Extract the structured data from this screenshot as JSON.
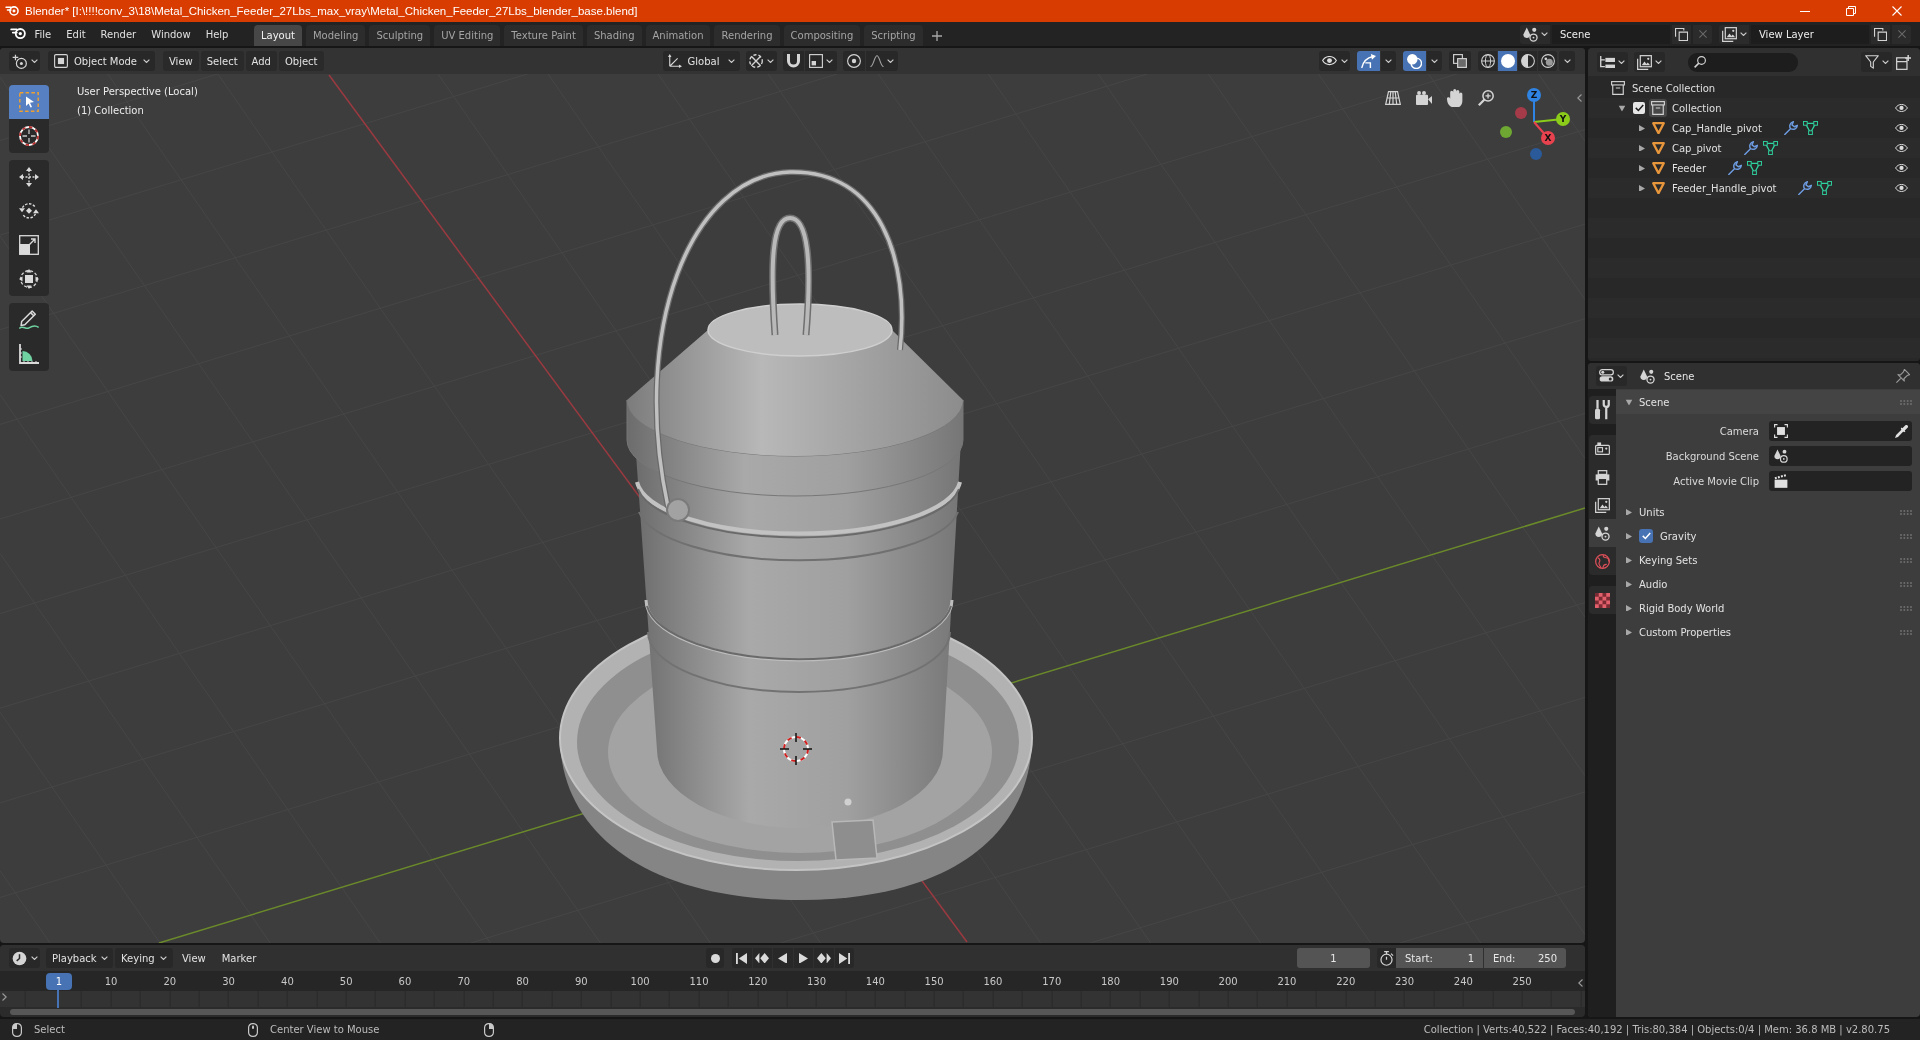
{
  "window": {
    "title": "Blender* [I:\\!!!!conv_3\\18\\Metal_Chicken_Feeder_27Lbs_max_vray\\Metal_Chicken_Feeder_27Lbs_blender_base.blend]"
  },
  "menu": [
    "File",
    "Edit",
    "Render",
    "Window",
    "Help"
  ],
  "workspaces": [
    {
      "label": "Layout",
      "selected": true
    },
    {
      "label": "Modeling",
      "selected": false
    },
    {
      "label": "Sculpting",
      "selected": false
    },
    {
      "label": "UV Editing",
      "selected": false
    },
    {
      "label": "Texture Paint",
      "selected": false
    },
    {
      "label": "Shading",
      "selected": false
    },
    {
      "label": "Animation",
      "selected": false
    },
    {
      "label": "Rendering",
      "selected": false
    },
    {
      "label": "Compositing",
      "selected": false
    },
    {
      "label": "Scripting",
      "selected": false
    }
  ],
  "scene": {
    "name": "Scene",
    "view_layer": "View Layer"
  },
  "viewport": {
    "mode": "Object Mode",
    "menus": [
      "View",
      "Select",
      "Add",
      "Object"
    ],
    "orientation": "Global",
    "toggles": {
      "gizmos": {
        "on": true
      },
      "overlays": {
        "on": true
      },
      "xray": {
        "on": false
      }
    },
    "shading": [
      {
        "kind": "wireframe",
        "selected": false
      },
      {
        "kind": "solid",
        "selected": true
      },
      {
        "kind": "material",
        "selected": false
      },
      {
        "kind": "rendered",
        "selected": false
      }
    ],
    "info": [
      "User Perspective (Local)",
      "(1) Collection"
    ],
    "tool_groups": [
      [
        {
          "kind": "select_box",
          "selected": true
        },
        {
          "kind": "cursor",
          "selected": false
        }
      ],
      [
        {
          "kind": "move",
          "selected": false
        },
        {
          "kind": "rotate",
          "selected": false
        },
        {
          "kind": "scale",
          "selected": false
        },
        {
          "kind": "transform",
          "selected": false
        }
      ],
      [
        {
          "kind": "annotate",
          "selected": false
        },
        {
          "kind": "measure",
          "selected": false
        }
      ]
    ],
    "axes": [
      {
        "kind": "z",
        "label": "Z"
      },
      {
        "kind": "y",
        "label": "Y"
      },
      {
        "kind": "x",
        "label": "X"
      }
    ]
  },
  "outliner": {
    "root": "Scene Collection",
    "tree": [
      {
        "name": "Collection",
        "checked": true,
        "expanded": true,
        "visible": true,
        "children": [
          {
            "name": "Cap_Handle_pivot",
            "expanded": false,
            "visible": true,
            "has_modifiers": true
          },
          {
            "name": "Cap_pivot",
            "expanded": false,
            "visible": true,
            "has_modifiers": true
          },
          {
            "name": "Feeder",
            "expanded": false,
            "visible": true,
            "has_modifiers": true
          },
          {
            "name": "Feeder_Handle_pivot",
            "expanded": false,
            "visible": true,
            "has_modifiers": true
          }
        ]
      }
    ]
  },
  "properties": {
    "context": "Scene",
    "tab_groups": [
      [
        {
          "kind": "tool",
          "selected": false
        }
      ],
      [
        {
          "kind": "render",
          "selected": false
        },
        {
          "kind": "output",
          "selected": false
        },
        {
          "kind": "view_layer",
          "selected": false
        },
        {
          "kind": "scene",
          "selected": true
        },
        {
          "kind": "world",
          "selected": false
        }
      ],
      [
        {
          "kind": "texture",
          "selected": false
        }
      ]
    ],
    "panels": [
      {
        "title": "Scene",
        "expanded": true,
        "fields": [
          {
            "kind": "camera",
            "label": "Camera"
          },
          {
            "kind": "scene",
            "label": "Background Scene"
          },
          {
            "kind": "clip",
            "label": "Active Movie Clip"
          }
        ]
      },
      {
        "title": "Units",
        "expanded": false
      },
      {
        "title": "Gravity",
        "expanded": false,
        "checked": true
      },
      {
        "title": "Keying Sets",
        "expanded": false
      },
      {
        "title": "Audio",
        "expanded": false
      },
      {
        "title": "Rigid Body World",
        "expanded": false
      },
      {
        "title": "Custom Properties",
        "expanded": false
      }
    ]
  },
  "timeline": {
    "menus": [
      {
        "kind": "dropdown",
        "label": "Playback"
      },
      {
        "kind": "dropdown",
        "label": "Keying"
      },
      {
        "kind": "menu",
        "label": "View"
      },
      {
        "kind": "menu",
        "label": "Marker"
      }
    ],
    "playhead": "1",
    "frame": "1",
    "start": {
      "label": "Start:",
      "value": "1"
    },
    "end": {
      "label": "End:",
      "value": "250"
    },
    "ruler": [
      "10",
      "20",
      "30",
      "40",
      "50",
      "60",
      "70",
      "80",
      "90",
      "100",
      "110",
      "120",
      "130",
      "140",
      "150",
      "160",
      "170",
      "180",
      "190",
      "200",
      "210",
      "220",
      "230",
      "240",
      "250"
    ]
  },
  "status_bar": {
    "hints": [
      {
        "kind": "left",
        "label": "Select"
      },
      {
        "kind": "middle",
        "label": "Center View to Mouse"
      },
      {
        "kind": "right"
      }
    ],
    "stats": "Collection | Verts:40,522 | Faces:40,192 | Tris:80,384 | Objects:0/4 | Mem: 36.8 MB | v2.80.75"
  }
}
